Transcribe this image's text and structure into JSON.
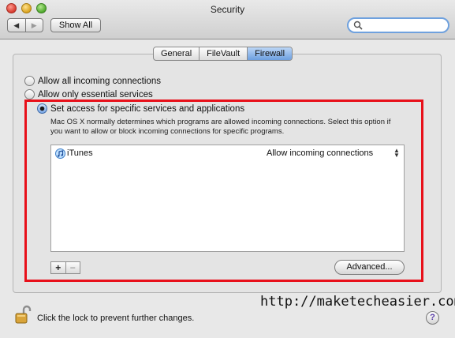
{
  "window": {
    "title": "Security"
  },
  "toolbar": {
    "back_icon": "chevron-left-icon",
    "forward_icon": "chevron-right-icon",
    "back_glyph": "◀",
    "forward_glyph": "▶",
    "show_all_label": "Show All",
    "search_value": "",
    "search_icon": "search-icon"
  },
  "tabs": [
    {
      "label": "General",
      "active": false
    },
    {
      "label": "FileVault",
      "active": false
    },
    {
      "label": "Firewall",
      "active": true
    }
  ],
  "firewall": {
    "options": [
      {
        "label": "Allow all incoming connections",
        "selected": false
      },
      {
        "label": "Allow only essential services",
        "selected": false
      },
      {
        "label": "Set access for specific services and applications",
        "selected": true
      }
    ],
    "description": "Mac OS X normally determines which programs are allowed incoming connections. Select this option if you want to allow or block incoming connections for specific programs.",
    "apps": [
      {
        "name": "iTunes",
        "icon": "itunes-icon",
        "setting": "Allow incoming connections"
      }
    ],
    "add_label": "+",
    "remove_label": "−",
    "advanced_label": "Advanced..."
  },
  "footer": {
    "lock_icon": "unlocked-lock-icon",
    "lock_text": "Click the lock to prevent further changes.",
    "help_label": "?"
  },
  "watermark": "http://maketecheasier.com",
  "colors": {
    "highlight_border": "#e8101a",
    "selected_tab": "#6d9fe0",
    "search_focus": "#6fa1de"
  }
}
